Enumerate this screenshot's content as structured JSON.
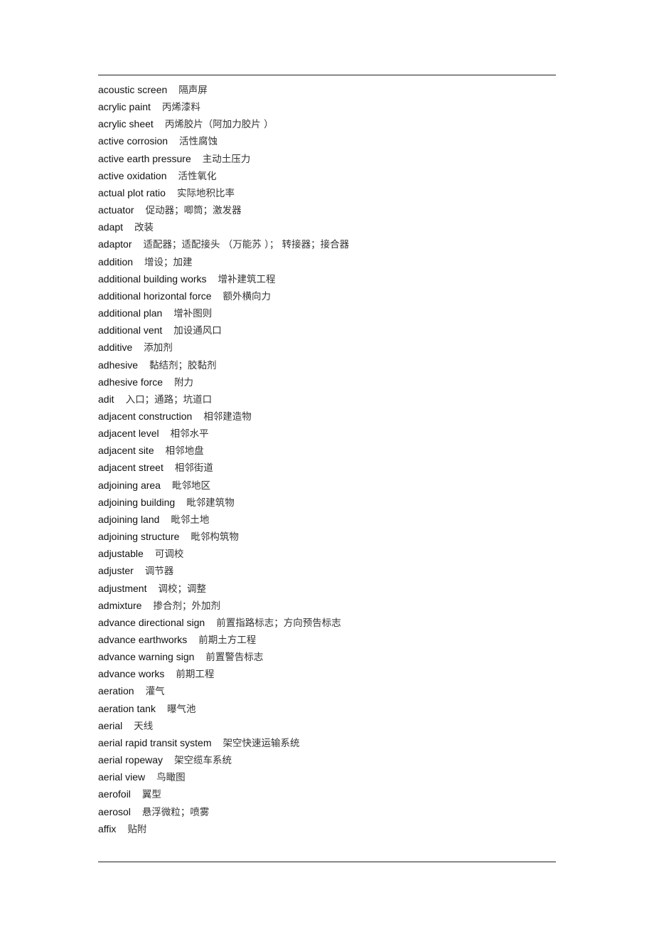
{
  "document": {
    "entries": [
      {
        "term": "acoustic screen",
        "definition": "隔声屏"
      },
      {
        "term": "acrylic paint",
        "definition": "丙烯漆料"
      },
      {
        "term": "acrylic sheet",
        "definition": "丙烯胶片（阿加力胶片 ）"
      },
      {
        "term": "active corrosion",
        "definition": "活性腐蚀"
      },
      {
        "term": "active earth pressure",
        "definition": "主动土压力"
      },
      {
        "term": "active oxidation",
        "definition": "活性氧化"
      },
      {
        "term": "actual plot ratio",
        "definition": "实际地积比率"
      },
      {
        "term": "actuator",
        "definition": "促动器；唧筒；激发器"
      },
      {
        "term": "adapt",
        "definition": "改装"
      },
      {
        "term": "adaptor",
        "definition": "适配器；适配接头 （万能苏 ）； 转接器；接合器"
      },
      {
        "term": "addition",
        "definition": "增设；加建"
      },
      {
        "term": "additional building works",
        "definition": "增补建筑工程"
      },
      {
        "term": "additional horizontal force",
        "definition": "额外横向力"
      },
      {
        "term": "additional plan",
        "definition": "增补图则"
      },
      {
        "term": "additional vent",
        "definition": "加设通风口"
      },
      {
        "term": "additive",
        "definition": "添加剂"
      },
      {
        "term": "adhesive",
        "definition": "黏结剂；胶黏剂"
      },
      {
        "term": "adhesive force",
        "definition": "附力"
      },
      {
        "term": "adit",
        "definition": "入口；通路；坑道口"
      },
      {
        "term": "adjacent construction",
        "definition": "相邻建造物"
      },
      {
        "term": "adjacent level",
        "definition": "相邻水平"
      },
      {
        "term": "adjacent site",
        "definition": "相邻地盘"
      },
      {
        "term": "adjacent street",
        "definition": "相邻街道"
      },
      {
        "term": "adjoining area",
        "definition": "毗邻地区"
      },
      {
        "term": "adjoining building",
        "definition": "毗邻建筑物"
      },
      {
        "term": "adjoining land",
        "definition": "毗邻土地"
      },
      {
        "term": "adjoining structure",
        "definition": "毗邻构筑物"
      },
      {
        "term": "adjustable",
        "definition": "可调校"
      },
      {
        "term": "adjuster",
        "definition": "调节器"
      },
      {
        "term": "adjustment",
        "definition": "调校；调整"
      },
      {
        "term": "admixture",
        "definition": "掺合剂；外加剂"
      },
      {
        "term": "advance directional sign",
        "definition": "前置指路标志；方向预告标志"
      },
      {
        "term": "advance earthworks",
        "definition": "前期土方工程"
      },
      {
        "term": "advance warning sign",
        "definition": "前置警告标志"
      },
      {
        "term": "advance works",
        "definition": "前期工程"
      },
      {
        "term": "aeration",
        "definition": "灌气"
      },
      {
        "term": "aeration tank",
        "definition": "曝气池"
      },
      {
        "term": "aerial",
        "definition": "天线"
      },
      {
        "term": "aerial rapid transit system",
        "definition": "架空快速运输系统"
      },
      {
        "term": "aerial ropeway",
        "definition": "架空缆车系统"
      },
      {
        "term": "aerial view",
        "definition": "鸟瞰图"
      },
      {
        "term": "aerofoil",
        "definition": "翼型"
      },
      {
        "term": "aerosol",
        "definition": "悬浮微粒；喷雾"
      },
      {
        "term": "affix",
        "definition": "贴附"
      }
    ]
  }
}
